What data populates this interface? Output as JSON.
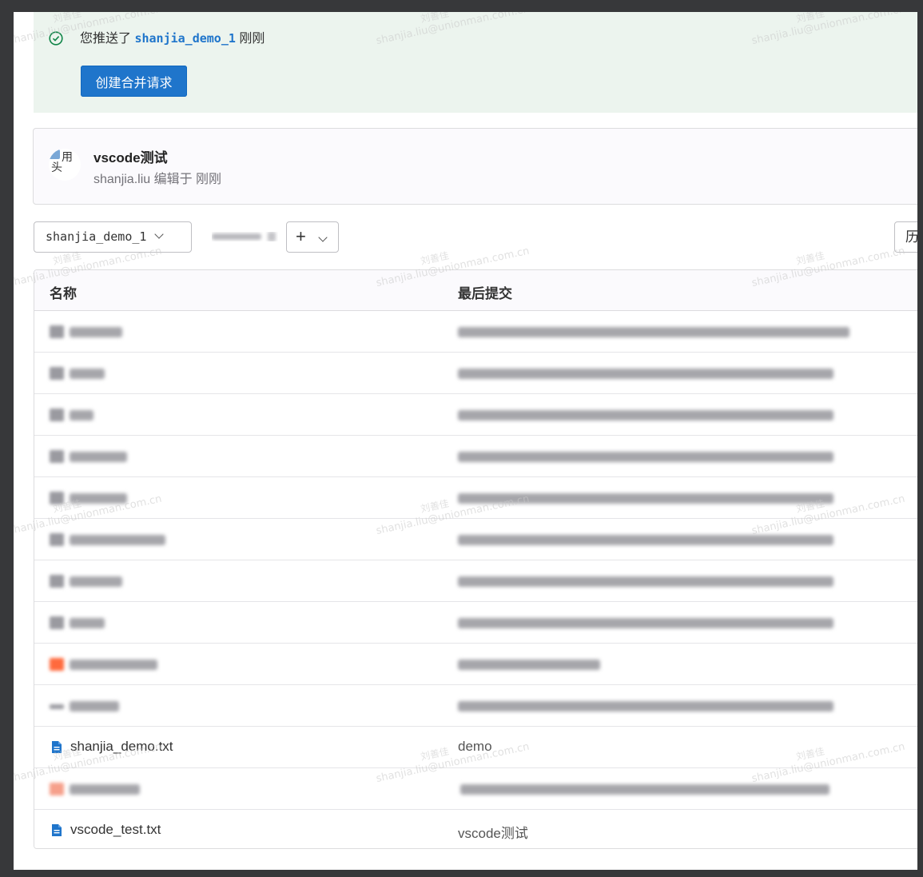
{
  "banner": {
    "prefix": "您推送了",
    "branch": "shanjia_demo_1",
    "suffix": "刚刚",
    "button_label": "创建合并请求"
  },
  "commit": {
    "avatar_alt_line1": "用",
    "avatar_alt_line2": "头",
    "title": "vscode测试",
    "meta": "shanjia.liu 编辑于 刚刚"
  },
  "toolbar": {
    "branch": "shanjia_demo_1",
    "add_label": "+",
    "history_label": "历"
  },
  "table": {
    "headers": {
      "name": "名称",
      "last_commit": "最后提交"
    },
    "rows": [
      {
        "name": "",
        "commit": "",
        "blurred": true,
        "icon": "folder-icon"
      },
      {
        "name": "",
        "commit": "",
        "blurred": true,
        "icon": "folder-icon"
      },
      {
        "name": "",
        "commit": "",
        "blurred": true,
        "icon": "folder-icon"
      },
      {
        "name": "",
        "commit": "",
        "blurred": true,
        "icon": "folder-icon"
      },
      {
        "name": "",
        "commit": "",
        "blurred": true,
        "icon": "folder-icon"
      },
      {
        "name": "",
        "commit": "",
        "blurred": true,
        "icon": "folder-icon"
      },
      {
        "name": "",
        "commit": "",
        "blurred": true,
        "icon": "folder-icon"
      },
      {
        "name": "",
        "commit": "",
        "blurred": true,
        "icon": "folder-icon"
      },
      {
        "name": "",
        "commit": "",
        "blurred": true,
        "icon": "gitlab-file-icon"
      },
      {
        "name": "",
        "commit": "",
        "blurred": true,
        "icon": "file-icon"
      },
      {
        "name": "shanjia_demo.txt",
        "commit": "demo",
        "blurred": false,
        "icon": "text-file-icon"
      },
      {
        "name": "",
        "commit": "",
        "blurred": true,
        "icon": "file-icon"
      },
      {
        "name": "vscode_test.txt",
        "commit": "vscode测试",
        "blurred": false,
        "icon": "text-file-icon"
      }
    ]
  },
  "watermark": {
    "name": "刘善佳",
    "email": "shanjia.liu@unionman.com.cn"
  },
  "colors": {
    "accent": "#1f75cb",
    "banner_bg": "#ecf4ee",
    "success": "#108548"
  }
}
